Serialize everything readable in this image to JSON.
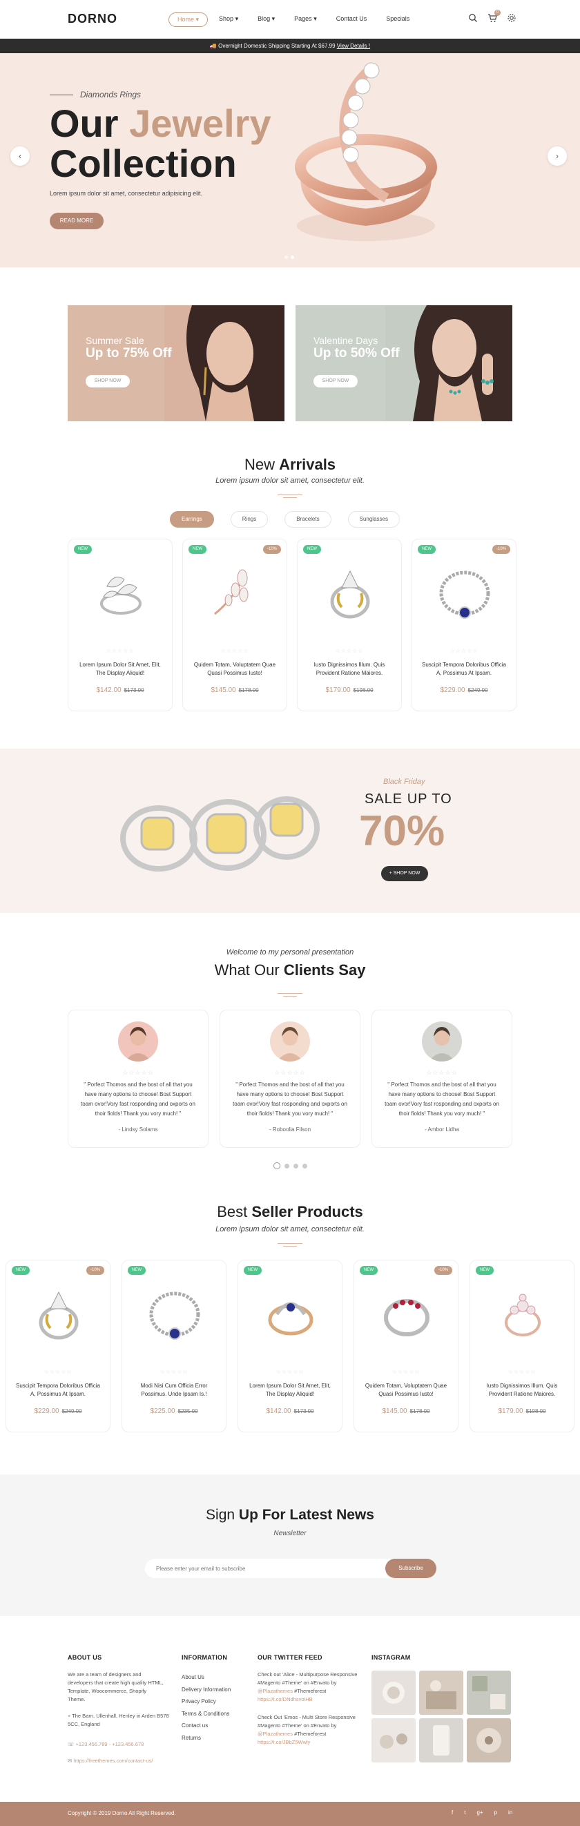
{
  "header": {
    "logo": "DORNO",
    "nav": [
      "Home",
      "Shop",
      "Blog",
      "Pages",
      "Contact Us",
      "Specials"
    ],
    "cart_count": "0"
  },
  "topbar": {
    "text": "Overnight Domestic Shipping Starting At $67.99",
    "link": "View Details !"
  },
  "hero": {
    "subtitle": "Diamonds Rings",
    "title_1": "Our",
    "title_accent": "Jewelry",
    "title_2": "Collection",
    "desc": "Lorem ipsum dolor sit amet, consectetur adipisicing elit.",
    "button": "READ MORE"
  },
  "banners": [
    {
      "line1": "Summer Sale",
      "line2": "Up to 75% Off",
      "button": "SHOP NOW"
    },
    {
      "line1": "Valentine Days",
      "line2": "Up to 50% Off",
      "button": "SHOP NOW"
    }
  ],
  "arrivals": {
    "title_light": "New",
    "title_bold": "Arrivals",
    "subtitle": "Lorem ipsum dolor sit amet, consectetur elit.",
    "tabs": [
      "Earrings",
      "Rings",
      "Bracelets",
      "Sunglasses"
    ],
    "products": [
      {
        "badge_new": "NEW",
        "badge_sale": "",
        "stars": "☆☆☆☆☆",
        "name": "Lorem Ipsum Dolor Sit Amet, Elit, The Display Aliquid!",
        "price": "$142.00",
        "old": "$173.00"
      },
      {
        "badge_new": "NEW",
        "badge_sale": "-10%",
        "stars": "☆☆☆☆☆",
        "name": "Quidem Totam, Voluptatem Quae Quasi Possimus Iusto!",
        "price": "$145.00",
        "old": "$178.00"
      },
      {
        "badge_new": "NEW",
        "badge_sale": "",
        "stars": "☆☆☆☆☆",
        "name": "Iusto Dignissimos Illum. Quis Provident Ratione Maiores.",
        "price": "$179.00",
        "old": "$198.00"
      },
      {
        "badge_new": "NEW",
        "badge_sale": "-10%",
        "stars": "☆☆☆☆☆",
        "name": "Suscipit Tempora Doloribus Officia A, Possimus At Ipsam.",
        "price": "$229.00",
        "old": "$249.00"
      }
    ]
  },
  "black_friday": {
    "small": "Black Friday",
    "sale": "SALE UP TO",
    "percent": "70%",
    "button": "+ SHOP NOW"
  },
  "testimonials": {
    "small": "Welcome to my personal presentation",
    "title_light": "What Our",
    "title_bold": "Clients Say",
    "items": [
      {
        "stars": "☆☆☆☆☆",
        "quote": "\" Porfect Thomos and the bost of all that you have many options to choose! Bost Support toam ovor!Vory fast rosponding and oxports on thoir fiolds! Thank you vory much! \"",
        "name": "- Lindsy Solams"
      },
      {
        "stars": "☆☆☆☆☆",
        "quote": "\" Porfect Thomos and the bost of all that you have many options to choose! Bost Support toam ovor!Vory fast rosponding and oxports on thoir fiolds! Thank you vory much! \"",
        "name": "- Roboolia Filson"
      },
      {
        "stars": "☆☆☆☆☆",
        "quote": "\" Porfect Thomos and the bost of all that you have many options to choose! Bost Support toam ovor!Vory fast rosponding and oxports on thoir fiolds! Thank you vory much! \"",
        "name": "- Ambor Lidha"
      }
    ]
  },
  "bestseller": {
    "title_light": "Best",
    "title_bold": "Seller Products",
    "subtitle": "Lorem ipsum dolor sit amet, consectetur elit.",
    "products": [
      {
        "badge_new": "NEW",
        "badge_sale": "-10%",
        "stars": "☆☆☆☆☆",
        "name": "Suscipit Tempora Doloribus Officia A, Possimus At Ipsam.",
        "price": "$229.00",
        "old": "$249.00"
      },
      {
        "badge_new": "NEW",
        "badge_sale": "",
        "stars": "☆☆☆☆☆",
        "name": "Modi Nisi Cum Officia Error Possimus. Unde Ipsam Is.!",
        "price": "$225.00",
        "old": "$235.00"
      },
      {
        "badge_new": "NEW",
        "badge_sale": "",
        "stars": "☆☆☆☆☆",
        "name": "Lorem Ipsum Dolor Sit Amet, Elit, The Display Aliquid!",
        "price": "$142.00",
        "old": "$173.00"
      },
      {
        "badge_new": "NEW",
        "badge_sale": "-10%",
        "stars": "☆☆☆☆☆",
        "name": "Quidem Totam, Voluptatem Quae Quasi Possimus Iusto!",
        "price": "$145.00",
        "old": "$178.00"
      },
      {
        "badge_new": "NEW",
        "badge_sale": "",
        "stars": "☆☆☆☆☆",
        "name": "Iusto Dignissimos Illum. Quis Provident Ratione Maiores.",
        "price": "$179.00",
        "old": "$198.00"
      }
    ]
  },
  "newsletter": {
    "title_light": "Sign",
    "title_bold": "Up For Latest News",
    "subtitle": "Newsletter",
    "placeholder": "Please enter your email to subscribe",
    "button": "Subscribe"
  },
  "footer": {
    "about_title": "ABOUT US",
    "about_text": "We are a team of designers and developers that create high quality HTML, Template, Woocommerce, Shopify Theme.",
    "address": "The Barn, Ullenhall, Henley in Arden B578 5CC, England",
    "phone": "+123.456.789 - +123.456.678",
    "website": "https://freethemes.com/contact-us/",
    "info_title": "INFORMATION",
    "info_links": [
      "About Us",
      "Delivery Information",
      "Privacy Policy",
      "Terms & Conditions",
      "Contact us",
      "Returns"
    ],
    "twitter_title": "OUR TWITTER FEED",
    "tweet1_a": "Check out 'Alice - Multipurpose Responsive #Magento #Theme' on #Envato by",
    "tweet1_b": "@Plazathemes",
    "tweet1_c": "#Themeforest",
    "tweet1_d": "https://t.co/DNdhsvoiHB",
    "tweet2_a": "Check Out 'Emos - Multi Store Responsive #Magento #Theme' on #Envato by",
    "tweet2_b": "@Plazathemes",
    "tweet2_c": "#Themeforest",
    "tweet2_d": "https://t.co/JBbZ5Wwly",
    "insta_title": "INSTAGRAM",
    "copyright": "Copyright © 2019 Dorno All Right Reserved.",
    "social": [
      "f",
      "t",
      "g+",
      "p",
      "in"
    ]
  },
  "colors": {
    "accent": "#c69c82",
    "accent_dark": "#b58671",
    "new_badge": "#4fc48b",
    "hero_bg": "#f7e8e1"
  }
}
